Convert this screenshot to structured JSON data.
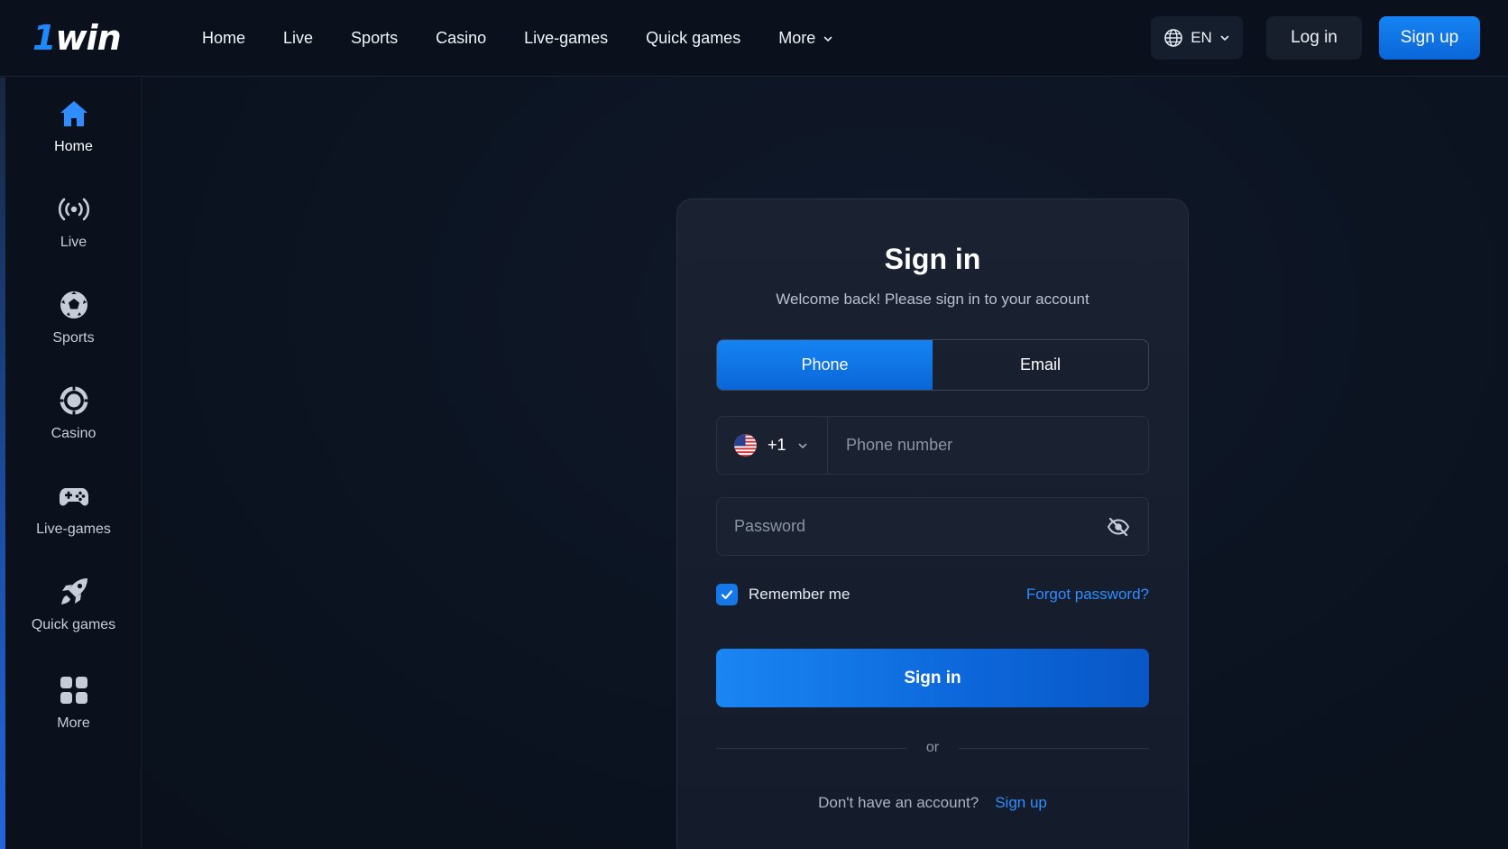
{
  "brand": {
    "logo_one": "1",
    "logo_win": "win"
  },
  "topnav": {
    "items": [
      "Home",
      "Live",
      "Sports",
      "Casino",
      "Live-games",
      "Quick games",
      "More"
    ]
  },
  "header": {
    "language": "EN",
    "login_label": "Log in",
    "signup_label": "Sign up"
  },
  "sidebar": {
    "items": [
      {
        "label": "Home",
        "icon": "home-icon",
        "active": true
      },
      {
        "label": "Live",
        "icon": "broadcast-icon",
        "active": false
      },
      {
        "label": "Sports",
        "icon": "soccer-ball-icon",
        "active": false
      },
      {
        "label": "Casino",
        "icon": "casino-chip-icon",
        "active": false
      },
      {
        "label": "Live-games",
        "icon": "gamepad-icon",
        "active": false
      },
      {
        "label": "Quick games",
        "icon": "rocket-icon",
        "active": false
      },
      {
        "label": "More",
        "icon": "grid-icon",
        "active": false
      }
    ]
  },
  "signin": {
    "title": "Sign in",
    "subtitle": "Welcome back! Please sign in to your account",
    "tabs": [
      {
        "label": "Phone",
        "active": true
      },
      {
        "label": "Email",
        "active": false
      }
    ],
    "country_code": "+1",
    "country_flag": "us-flag-icon",
    "phone_placeholder": "Phone number",
    "password_placeholder": "Password",
    "remember_label": "Remember me",
    "remember_checked": true,
    "forgot_label": "Forgot password?",
    "submit_label": "Sign in",
    "divider_label": "or",
    "no_account_label": "Don't have an account?",
    "signup_link_label": "Sign up"
  },
  "colors": {
    "accent": "#1583f2",
    "link": "#2f8dff",
    "background": "#0c1422",
    "card": "#171f2e"
  }
}
